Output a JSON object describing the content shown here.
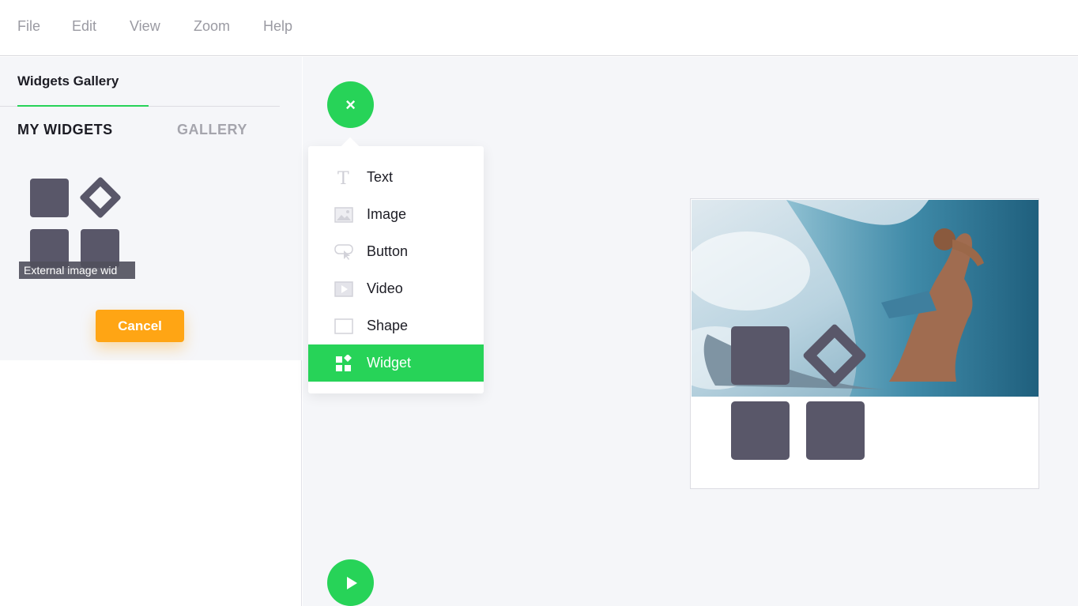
{
  "menubar": {
    "items": [
      {
        "label": "File"
      },
      {
        "label": "Edit"
      },
      {
        "label": "View"
      },
      {
        "label": "Zoom"
      },
      {
        "label": "Help"
      }
    ]
  },
  "sidebar": {
    "title": "Widgets Gallery",
    "tabs": [
      {
        "label": "MY WIDGETS",
        "active": true
      },
      {
        "label": "GALLERY",
        "active": false
      }
    ],
    "widget": {
      "label": "External image wid"
    },
    "cancel_label": "Cancel"
  },
  "canvas": {
    "close_symbol": "×",
    "add_menu": {
      "items": [
        {
          "label": "Text",
          "icon": "text-icon"
        },
        {
          "label": "Image",
          "icon": "image-icon"
        },
        {
          "label": "Button",
          "icon": "button-icon"
        },
        {
          "label": "Video",
          "icon": "video-icon"
        },
        {
          "label": "Shape",
          "icon": "shape-icon"
        },
        {
          "label": "Widget",
          "icon": "widget-icon",
          "selected": true
        }
      ]
    }
  },
  "colors": {
    "accent_green": "#27d358",
    "cancel_orange": "#ffa514",
    "widget_gray": "#595769"
  }
}
